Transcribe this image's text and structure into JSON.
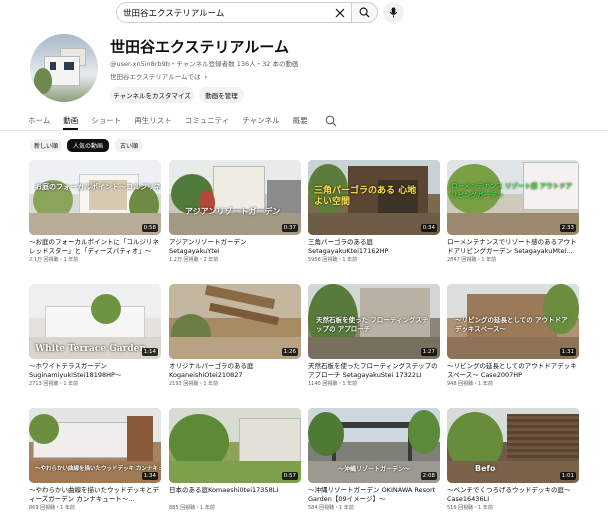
{
  "search": {
    "query": "世田谷エクステリアルーム"
  },
  "channel": {
    "title": "世田谷エクステリアルーム",
    "meta": "@user-xn5in8rb9b・チャンネル登録者数 136人・32 本の動画",
    "description": "世田谷エクステリアルームでは",
    "customize_label": "チャンネルをカスタマイズ",
    "manage_label": "動画を管理"
  },
  "tabs": [
    "ホーム",
    "動画",
    "ショート",
    "再生リスト",
    "コミュニティ",
    "チャンネル",
    "概要"
  ],
  "active_tab": "動画",
  "chips": [
    "新しい順",
    "人気の動画",
    "古い順"
  ],
  "active_chip": "人気の動画",
  "videos": [
    {
      "title": "〜お庭のフォーカルポイントに「コルジリネ レッドスター」と「ディーズパティオ」〜",
      "meta": "2.1万 回視聴・1 年前",
      "duration": "0:58",
      "overlay": "お庭のフォーカルポイント〜コルジリネ レッド・ディーズパティオ"
    },
    {
      "title": "アジアンリゾートガーデン　SetagayakuYtei",
      "meta": "1.2万 回視聴・2 年前",
      "duration": "0:37",
      "overlay": "アジアンリゾートガーデン"
    },
    {
      "title": "三角パーゴラのある庭 SetagayakuKtei17162HP",
      "meta": "5956 回視聴・1 年前",
      "duration": "0:34",
      "overlay": "三角パーゴラのある 心地よい空間"
    },
    {
      "title": "ローメンテナンスでリゾート感のあるアウトドアリビングガーデン SetagayakuMtei...",
      "meta": "2847 回視聴・1 年前",
      "duration": "2:33",
      "overlay": "ローメンテナンス リゾート感 アウトドアリビングガーデン"
    },
    {
      "title": "〜ホワイトテラスガーデン SuginamiyukiStei18198HP〜",
      "meta": "2713 回視聴・1 年前",
      "duration": "1:14",
      "overlay": "White Terrace Garden"
    },
    {
      "title": "オリジナルパーゴラのある庭 KoganeishiOtei210827",
      "meta": "2193 回視聴・1 年前",
      "duration": "1:26",
      "overlay": ""
    },
    {
      "title": "天然石板を使ったフローティングステップのアプローチ SetagayakuStei 17322LI",
      "meta": "1140 回視聴・1 年前",
      "duration": "1:27",
      "overlay": "天然石板を使った フローティングステップの アプローチ"
    },
    {
      "title": "〜リビングの延長としてのアウトドアデッキスペース〜 Case2007HP",
      "meta": "948 回視聴・1 年前",
      "duration": "1:31",
      "overlay": "〜リビングの延長としての アウトドアデッキスペース〜"
    },
    {
      "title": "〜やわらかい曲線を描いたウッドデッキとディーズガーデン カンナキュート〜...",
      "meta": "869 回視聴・1 年前",
      "duration": "1:34",
      "overlay": "〜やわらかい曲線を描いたウッドデッキ カンナキュート〜"
    },
    {
      "title": "日本のある庭Komaeshi0tei17358LI",
      "meta": "885 回視聴・1 年前",
      "duration": "0:57",
      "overlay": ""
    },
    {
      "title": "〜沖縄リゾートガーデン OKINAWA Resort Garden【09イメージ】〜",
      "meta": "584 回視聴・1 年前",
      "duration": "2:08",
      "overlay": "〜沖縄リゾートガーデン〜"
    },
    {
      "title": "〜ベンチでくつろげるウッドデッキの庭〜 Case16436LI",
      "meta": "516 回視聴・1 年前",
      "duration": "1:01",
      "overlay": "Befo"
    }
  ],
  "colors": {
    "active_chip_bg": "#0f0f0f",
    "text_secondary": "#606060",
    "chip_bg": "#f2f2f2"
  }
}
